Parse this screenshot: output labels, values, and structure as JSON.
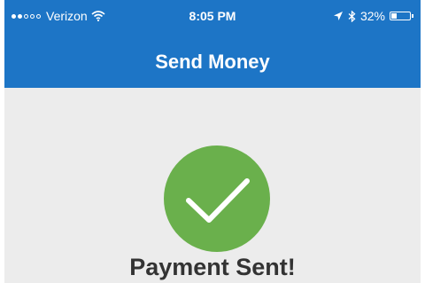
{
  "status_bar": {
    "carrier": "Verizon",
    "time": "8:05 PM",
    "battery_percent": "32%",
    "battery_level": 0.32,
    "signal_bars_filled": 2,
    "signal_bars_total": 5,
    "icons": [
      "wifi-icon",
      "location-arrow-icon",
      "bluetooth-icon",
      "battery-icon"
    ]
  },
  "header": {
    "title": "Send Money"
  },
  "main": {
    "status_icon": "checkmark-icon",
    "status_text": "Payment Sent!"
  },
  "colors": {
    "header_background": "#1d75c6",
    "page_background": "#ececec",
    "success_green": "#6ab04c",
    "text_dark": "#333333"
  }
}
